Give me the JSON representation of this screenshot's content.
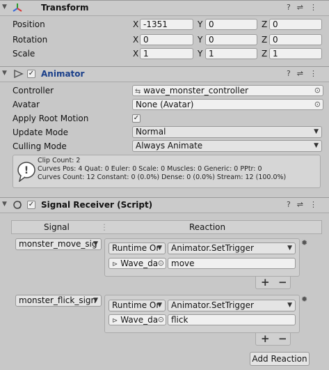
{
  "transform": {
    "title": "Transform",
    "position": {
      "label": "Position",
      "x": "-1351",
      "y": "0",
      "z": "0"
    },
    "rotation": {
      "label": "Rotation",
      "x": "0",
      "y": "0",
      "z": "0"
    },
    "scale": {
      "label": "Scale",
      "x": "1",
      "y": "1",
      "z": "1"
    },
    "axis_labels": {
      "x": "X",
      "y": "Y",
      "z": "Z"
    }
  },
  "animator": {
    "title": "Animator",
    "controller": {
      "label": "Controller",
      "value": "wave_monster_controller"
    },
    "avatar": {
      "label": "Avatar",
      "value": "None (Avatar)"
    },
    "apply_root_motion": {
      "label": "Apply Root Motion",
      "checked": true
    },
    "update_mode": {
      "label": "Update Mode",
      "value": "Normal"
    },
    "culling_mode": {
      "label": "Culling Mode",
      "value": "Always Animate"
    },
    "info": [
      "Clip Count: 2",
      "Curves Pos: 4 Quat: 0 Euler: 0 Scale: 0 Muscles: 0 Generic: 0 PPtr: 0",
      "Curves Count: 12 Constant: 0 (0.0%) Dense: 0 (0.0%) Stream: 12 (100.0%)"
    ]
  },
  "signal_receiver": {
    "title": "Signal Receiver (Script)",
    "col_signal": "Signal",
    "col_reaction": "Reaction",
    "rows": [
      {
        "signal": "monster_move_sig",
        "runtime": "Runtime Or",
        "method": "Animator.SetTrigger",
        "object": "Wave_da",
        "arg": "move"
      },
      {
        "signal": "monster_flick_sign",
        "runtime": "Runtime Or",
        "method": "Animator.SetTrigger",
        "object": "Wave_da",
        "arg": "flick"
      }
    ],
    "plus": "+",
    "minus": "−",
    "add_reaction": "Add Reaction"
  },
  "icons": {
    "header_help": "?",
    "header_settings": "⇌",
    "header_more": "⋮"
  },
  "colors": {
    "animator_title": "#1a3f8a",
    "panel_bg": "#c8c8c8",
    "header_bg": "#cbcbcb"
  }
}
